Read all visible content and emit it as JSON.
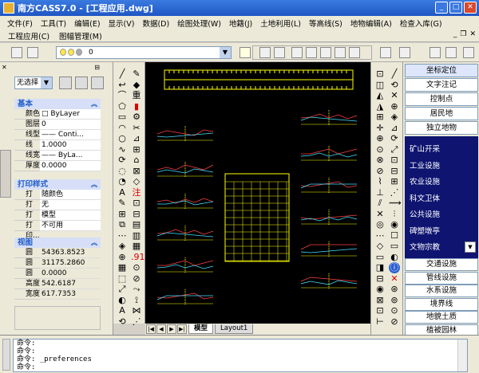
{
  "window": {
    "title": "南方CASS7.0 - [工程应用.dwg]"
  },
  "menubar": {
    "items": [
      "文件(F)",
      "工具(T)",
      "编辑(E)",
      "显示(V)",
      "数据(D)",
      "绘图处理(W)",
      "地籍(J)",
      "土地利用(L)",
      "等高线(S)",
      "地物编辑(A)",
      "检查入库(G)"
    ]
  },
  "menubar2": {
    "items": [
      "工程应用(C)",
      "图幅管理(M)"
    ]
  },
  "toolbar": {
    "layer_value": "0"
  },
  "properties": {
    "selection": "无选择",
    "sections": {
      "basic": "基本",
      "print": "打印样式",
      "view": "视图"
    },
    "basic_rows": [
      {
        "k": "颜色",
        "v": "□ ByLayer"
      },
      {
        "k": "图层",
        "v": "0"
      },
      {
        "k": "线型",
        "v": "—— Conti..."
      },
      {
        "k": "线型...",
        "v": "1.0000"
      },
      {
        "k": "线宽",
        "v": "—— ByLa..."
      },
      {
        "k": "厚度",
        "v": "0.0000"
      }
    ],
    "print_rows": [
      {
        "k": "打印...",
        "v": "随颜色"
      },
      {
        "k": "打印...",
        "v": "无"
      },
      {
        "k": "打印...",
        "v": "模型"
      },
      {
        "k": "打印...",
        "v": "不可用"
      }
    ],
    "view_rows": [
      {
        "k": "圆心...",
        "v": "54363.8523"
      },
      {
        "k": "圆心...",
        "v": "31175.2860"
      },
      {
        "k": "圆心...",
        "v": "0.0000"
      },
      {
        "k": "高度",
        "v": "542.6187"
      },
      {
        "k": "宽度",
        "v": "617.7353"
      }
    ]
  },
  "tabs": {
    "model": "模型",
    "layout": "Layout1"
  },
  "right_panel": {
    "top_buttons": [
      "坐标定位",
      "文字注记",
      "控制点",
      "居民地",
      "独立地物"
    ],
    "list_items": [
      "矿山开采",
      "工业设施",
      "农业设施",
      "科文卫体",
      "公共设施",
      "碑塑墩亭",
      "文物宗教"
    ],
    "bottom_buttons": [
      "交通设施",
      "管线设施",
      "水系设施",
      "境界线",
      "地貌土质",
      "植被园林"
    ]
  },
  "command": {
    "lines": [
      "命令:",
      "命令:",
      "命令:  _preferences",
      "命令:"
    ]
  },
  "drawing": {
    "tick_labels": [
      "A",
      "B",
      "C",
      "D",
      "E",
      "F",
      "G"
    ]
  }
}
